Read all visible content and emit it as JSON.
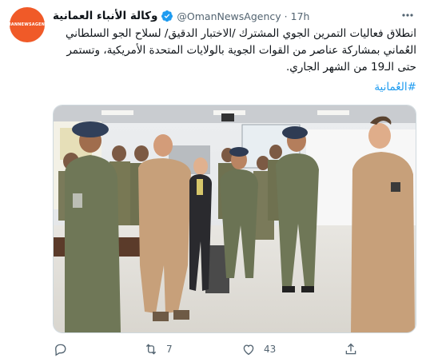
{
  "account": {
    "display_name": "وكالة الأنباء العمانية",
    "handle": "@OmanNewsAgency",
    "separator": "·",
    "time": "17h",
    "avatar_text": "OMANNEWSAGENCY"
  },
  "tweet": {
    "text": "انطلاق فعاليات التمرين الجوي المشترك /الاختبار الدقيق/ لسلاح الجو السلطاني العُماني بمشاركة عناصر من القوات الجوية بالولايات المتحدة الأمريكية، وتستمر حتى الـ19 من الشهر الجاري.",
    "hashtag": "#العُمانية"
  },
  "actions": {
    "reply_count": "",
    "retweet_count": "7",
    "like_count": "43"
  },
  "icons": {
    "verified": "verified-badge-icon",
    "more": "more-options-icon",
    "reply": "reply-icon",
    "retweet": "retweet-icon",
    "like": "heart-icon",
    "share": "share-icon"
  },
  "colors": {
    "accent": "#1d9bf0",
    "avatar_bg": "#f05a28",
    "muted": "#536471"
  }
}
